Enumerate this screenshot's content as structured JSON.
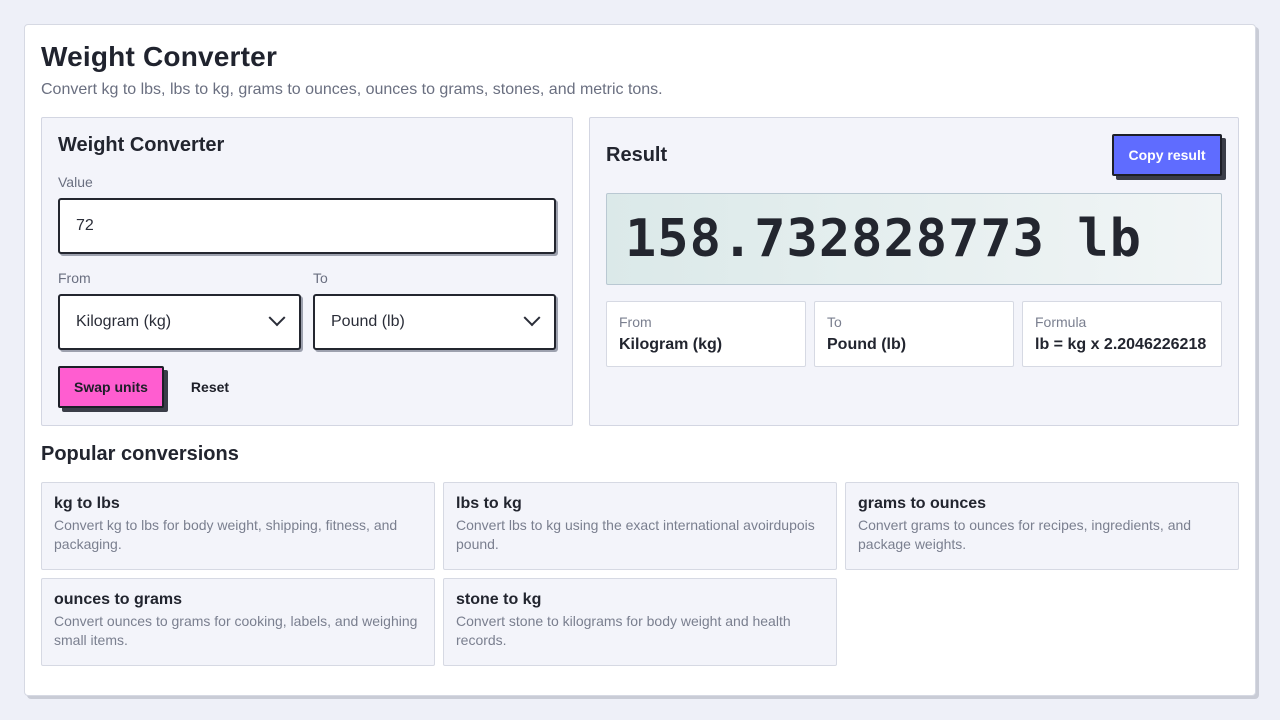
{
  "header": {
    "title": "Weight Converter",
    "subtitle": "Convert kg to lbs, lbs to kg, grams to ounces, ounces to grams, stones, and metric tons."
  },
  "converter": {
    "title": "Weight Converter",
    "value_label": "Value",
    "value": "72",
    "from_label": "From",
    "from_value": "Kilogram (kg)",
    "to_label": "To",
    "to_value": "Pound (lb)",
    "swap_label": "Swap units",
    "reset_label": "Reset"
  },
  "result": {
    "title": "Result",
    "copy_label": "Copy result",
    "value": "158.732828773 lb",
    "details": [
      {
        "label": "From",
        "value": "Kilogram (kg)"
      },
      {
        "label": "To",
        "value": "Pound (lb)"
      },
      {
        "label": "Formula",
        "value": "lb = kg x 2.2046226218"
      }
    ]
  },
  "popular": {
    "heading": "Popular conversions",
    "items": [
      {
        "title": "kg to lbs",
        "desc": "Convert kg to lbs for body weight, shipping, fitness, and packaging."
      },
      {
        "title": "lbs to kg",
        "desc": "Convert lbs to kg using the exact international avoirdupois pound."
      },
      {
        "title": "grams to ounces",
        "desc": "Convert grams to ounces for recipes, ingredients, and package weights."
      },
      {
        "title": "ounces to grams",
        "desc": "Convert ounces to grams for cooking, labels, and weighing small items."
      },
      {
        "title": "stone to kg",
        "desc": "Convert stone to kilograms for body weight and health records."
      }
    ]
  },
  "colors": {
    "swap_button": "#ff5dd0",
    "copy_button": "#5f6cff",
    "background": "#eef0f8"
  },
  "icons": {
    "select_arrow": "chevron-down-icon"
  }
}
